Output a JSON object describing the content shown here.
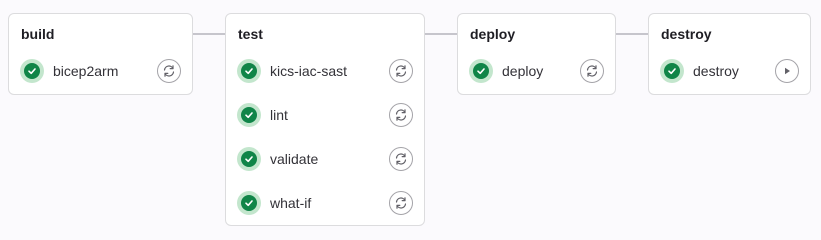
{
  "stages": [
    {
      "name": "build",
      "jobs": [
        {
          "name": "bicep2arm",
          "status": "success",
          "action": "retry"
        }
      ]
    },
    {
      "name": "test",
      "jobs": [
        {
          "name": "kics-iac-sast",
          "status": "success",
          "action": "retry"
        },
        {
          "name": "lint",
          "status": "success",
          "action": "retry"
        },
        {
          "name": "validate",
          "status": "success",
          "action": "retry"
        },
        {
          "name": "what-if",
          "status": "success",
          "action": "retry"
        }
      ]
    },
    {
      "name": "deploy",
      "jobs": [
        {
          "name": "deploy",
          "status": "success",
          "action": "retry"
        }
      ]
    },
    {
      "name": "destroy",
      "jobs": [
        {
          "name": "destroy",
          "status": "success",
          "action": "run"
        }
      ]
    }
  ],
  "colors": {
    "success": "#108548",
    "success_bg": "#c3e6cd",
    "connector": "#c6c5cc"
  }
}
